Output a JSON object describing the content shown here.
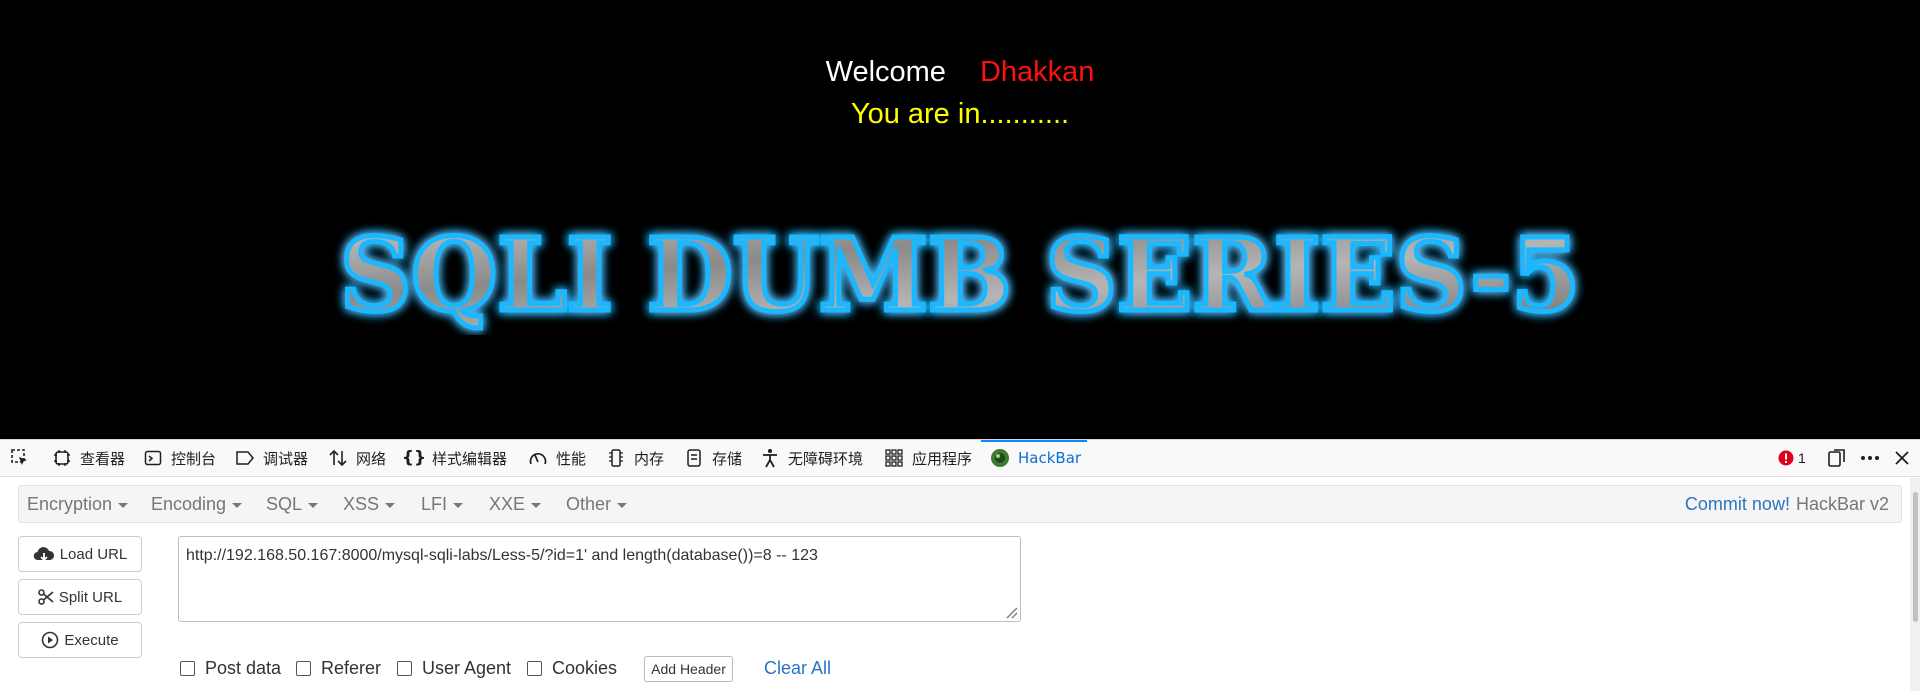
{
  "page": {
    "welcome": "Welcome",
    "username": "Dhakkan",
    "status": "You are in...........",
    "banner": "SQLI DUMB SERIES-5"
  },
  "devtools": {
    "tabs": [
      {
        "label": "查看器",
        "icon": "inspector-icon"
      },
      {
        "label": "控制台",
        "icon": "console-icon"
      },
      {
        "label": "调试器",
        "icon": "debugger-icon"
      },
      {
        "label": "网络",
        "icon": "network-icon"
      },
      {
        "label": "样式编辑器",
        "icon": "style-editor-icon"
      },
      {
        "label": "性能",
        "icon": "performance-icon"
      },
      {
        "label": "内存",
        "icon": "memory-icon"
      },
      {
        "label": "存储",
        "icon": "storage-icon"
      },
      {
        "label": "无障碍环境",
        "icon": "accessibility-icon"
      },
      {
        "label": "应用程序",
        "icon": "application-icon"
      },
      {
        "label": "HackBar",
        "icon": "hackbar-icon"
      }
    ],
    "error_count": "1"
  },
  "hackbar": {
    "menus": [
      "Encryption",
      "Encoding",
      "SQL",
      "XSS",
      "LFI",
      "XXE",
      "Other"
    ],
    "commit_label": "Commit now!",
    "brand": "HackBar v2",
    "buttons": {
      "load": "Load URL",
      "split": "Split URL",
      "execute": "Execute"
    },
    "url": "http://192.168.50.167:8000/mysql-sqli-labs/Less-5/?id=1' and length(database())=8 -- 123",
    "options": [
      "Post data",
      "Referer",
      "User Agent",
      "Cookies"
    ],
    "add_header": "Add Header",
    "clear_all": "Clear All"
  },
  "colors": {
    "background": "#000000",
    "username": "#ff1010",
    "status": "#ffff00",
    "accent": "#0a84ff"
  }
}
